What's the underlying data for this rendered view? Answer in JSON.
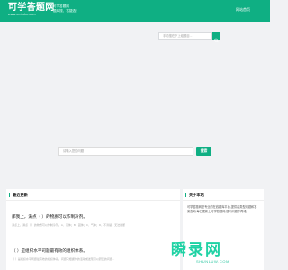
{
  "header": {
    "logo_text": "可学答题网",
    "logo_url": "www.zmbdm.com",
    "slogan_line1": "可学答题网",
    "slogan_line2": "题库搜，答疑选！",
    "nav_link": "网站首页"
  },
  "top_search": {
    "placeholder": "手动搜在下上组题目..."
  },
  "main_search": {
    "placeholder": "请输入您的问题",
    "button_label": "搜索"
  },
  "latest": {
    "title": "最近更新",
    "items": [
      {
        "title": "那我上，满点（ ）的物质可以作制冷剂。",
        "desc": "满点上，满点（ ）的物质可以作制冷剂。A、液体；B、固体；C、气体；D、不清楚，无法判断"
      },
      {
        "title": "（ ）是组织水平司题最有效的组织体系。",
        "desc": "（ ）是组织水平司题最有效的组织体系。问题只根据你的活动或发现可以研究的问题..."
      }
    ]
  },
  "about": {
    "title": "关于本站",
    "text": "可学答题网是专业的在线题库平台,提供各类型问题和答案查询,每日更新上可学答题网,题问问题不再难。"
  },
  "watermark": {
    "text": "瞬录网",
    "url": "SHUNLUW.COM"
  },
  "colors": {
    "accent": "#0faf83",
    "background": "#f1f2f4"
  }
}
